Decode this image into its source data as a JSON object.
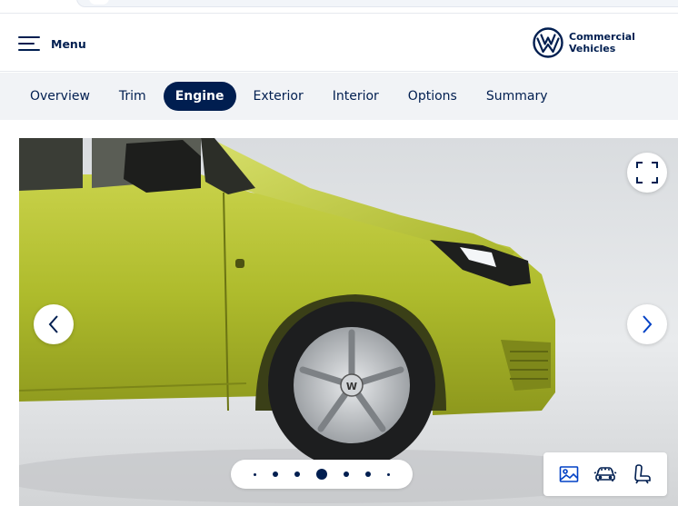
{
  "header": {
    "menu_label": "Menu",
    "brand_line1": "Commercial",
    "brand_line2": "Vehicles",
    "brand_color": "#001e50"
  },
  "tabs": [
    {
      "label": "Overview",
      "active": false
    },
    {
      "label": "Trim",
      "active": false
    },
    {
      "label": "Engine",
      "active": true
    },
    {
      "label": "Exterior",
      "active": false
    },
    {
      "label": "Interior",
      "active": false
    },
    {
      "label": "Options",
      "active": false
    },
    {
      "label": "Summary",
      "active": false
    }
  ],
  "viewer": {
    "vehicle_color": "#b8c23a",
    "icons": {
      "fullscreen": "fullscreen-icon",
      "prev": "chevron-left-icon",
      "next": "chevron-right-icon",
      "gallery": "image-icon",
      "exterior_view": "car-exterior-icon",
      "interior_view": "car-seat-icon"
    },
    "slides_total": 7,
    "slide_active": 4
  }
}
